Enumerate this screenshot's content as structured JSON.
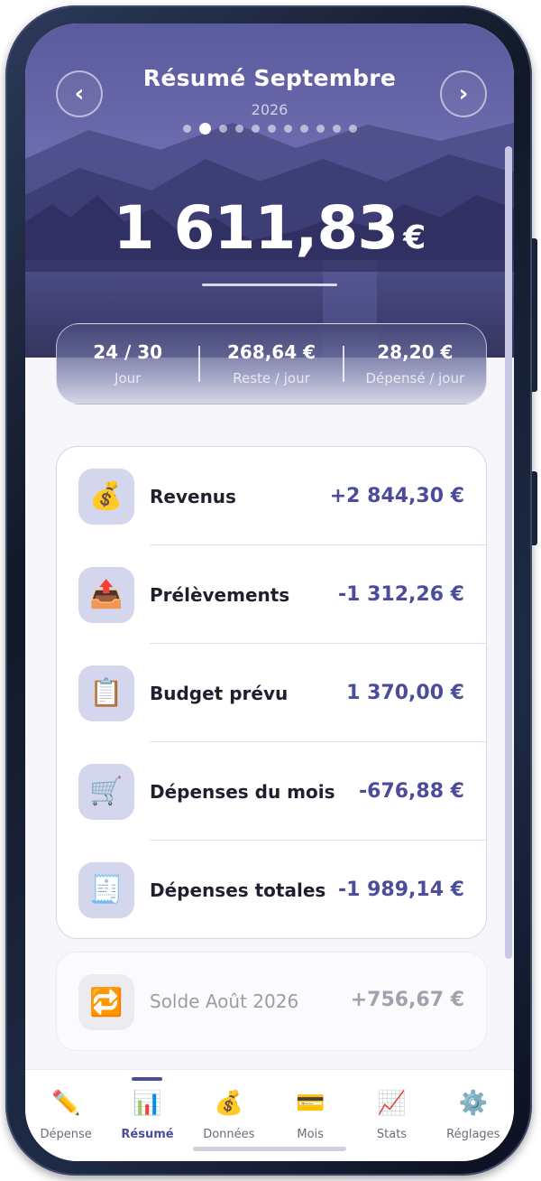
{
  "header": {
    "title": "Résumé Septembre",
    "year": "2026",
    "page_count": 11,
    "active_page": 2,
    "prev_icon": "chevron-left-icon",
    "next_icon": "chevron-right-icon"
  },
  "balance": {
    "amount": "1 611,83",
    "currency": "€"
  },
  "stats": [
    {
      "value": "24 / 30",
      "label": "Jour"
    },
    {
      "value": "268,64 €",
      "label": "Reste / jour"
    },
    {
      "value": "28,20 €",
      "label": "Dépensé / jour"
    }
  ],
  "summary_items": [
    {
      "icon": "money-bag-icon",
      "glyph": "💰",
      "label": "Revenus",
      "value": "+2 844,30 €"
    },
    {
      "icon": "outbox-tray-icon",
      "glyph": "📤",
      "label": "Prélèvements",
      "value": "-1 312,26 €"
    },
    {
      "icon": "clipboard-icon",
      "glyph": "📋",
      "label": "Budget prévu",
      "value": "1 370,00 €"
    },
    {
      "icon": "shopping-cart-icon",
      "glyph": "🛒",
      "label": "Dépenses du mois",
      "value": "-676,88 €"
    },
    {
      "icon": "receipt-icon",
      "glyph": "🧾",
      "label": "Dépenses totales",
      "value": "-1 989,14 €"
    }
  ],
  "previous_balance": {
    "icon": "repeat-icon",
    "glyph": "🔁",
    "label": "Solde Août 2026",
    "value": "+756,67 €"
  },
  "tabs": [
    {
      "icon": "pencil-icon",
      "glyph": "✏️",
      "label": "Dépense",
      "active": false
    },
    {
      "icon": "bar-chart-icon",
      "glyph": "📊",
      "label": "Résumé",
      "active": true
    },
    {
      "icon": "money-bag-icon",
      "glyph": "💰",
      "label": "Données",
      "active": false
    },
    {
      "icon": "credit-card-icon",
      "glyph": "💳",
      "label": "Mois",
      "active": false
    },
    {
      "icon": "chart-increasing-icon",
      "glyph": "📈",
      "label": "Stats",
      "active": false
    },
    {
      "icon": "gear-icon",
      "glyph": "⚙️",
      "label": "Réglages",
      "active": false
    }
  ],
  "colors": {
    "accent": "#4b4c9c",
    "hero_sky": "#4f4f8f"
  }
}
